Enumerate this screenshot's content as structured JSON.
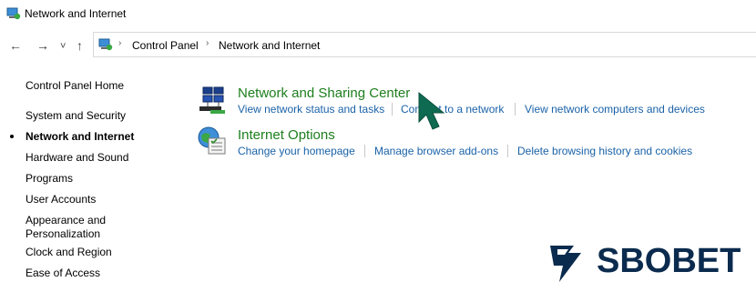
{
  "window": {
    "title": "Network and Internet"
  },
  "nav": {
    "back_glyph": "←",
    "forward_glyph": "→",
    "recent_glyph": "˅",
    "up_glyph": "↑",
    "breadcrumbs": [
      "Control Panel",
      "Network and Internet"
    ],
    "separator": "›"
  },
  "sidebar": {
    "items": [
      {
        "label": "Control Panel Home"
      },
      {
        "label": "System and Security"
      },
      {
        "label": "Network and Internet",
        "current": true
      },
      {
        "label": "Hardware and Sound"
      },
      {
        "label": "Programs"
      },
      {
        "label": "User Accounts"
      },
      {
        "label": "Appearance and Personalization"
      },
      {
        "label": "Clock and Region"
      },
      {
        "label": "Ease of Access"
      }
    ]
  },
  "categories": [
    {
      "title": "Network and Sharing Center",
      "icon": "network-sharing-icon",
      "links": [
        "View network status and tasks",
        "Connect to a network",
        "View network computers and devices"
      ]
    },
    {
      "title": "Internet Options",
      "icon": "internet-options-icon",
      "links": [
        "Change your homepage",
        "Manage browser add-ons",
        "Delete browsing history and cookies"
      ]
    }
  ],
  "watermark": {
    "text": "SBOBET",
    "color": "#0b2b4e"
  },
  "colors": {
    "category_title": "#1d7e1d",
    "link": "#1a62a8",
    "cursor": "#0e6b52"
  }
}
